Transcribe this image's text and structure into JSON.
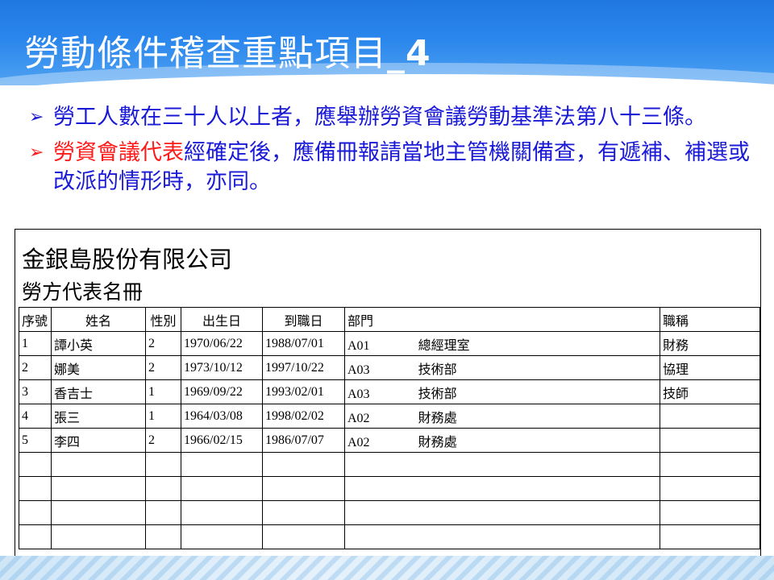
{
  "slide": {
    "title_main": "勞動條件稽查重點項目",
    "title_suffix": "_4",
    "bullets": [
      {
        "text": "勞工人數在三十人以上者，應舉辦勞資會議勞動基準法第八十三條。"
      },
      {
        "red": "勞資會議代表",
        "text": "經確定後，應備冊報請當地主管機關備查，有遞補、補選或改派的情形時，亦同。"
      }
    ]
  },
  "document": {
    "company": "金銀島股份有限公司",
    "subtitle": "勞方代表名冊",
    "columns": [
      "序號",
      "姓名",
      "性別",
      "出生日",
      "到職日",
      "部門",
      "職稱"
    ],
    "rows": [
      {
        "no": "1",
        "name": "譚小英",
        "gender": "2",
        "birth": "1970/06/22",
        "hire": "1988/07/01",
        "dept_code": "A01",
        "dept_name": "總經理室",
        "title": "財務"
      },
      {
        "no": "2",
        "name": "娜美",
        "gender": "2",
        "birth": "1973/10/12",
        "hire": "1997/10/22",
        "dept_code": "A03",
        "dept_name": "技術部",
        "title": "協理"
      },
      {
        "no": "3",
        "name": "香吉士",
        "gender": "1",
        "birth": "1969/09/22",
        "hire": "1993/02/01",
        "dept_code": "A03",
        "dept_name": "技術部",
        "title": "技師"
      },
      {
        "no": "4",
        "name": "張三",
        "gender": "1",
        "birth": "1964/03/08",
        "hire": "1998/02/02",
        "dept_code": "A02",
        "dept_name": "財務處",
        "title": ""
      },
      {
        "no": "5",
        "name": "李四",
        "gender": "2",
        "birth": "1966/02/15",
        "hire": "1986/07/07",
        "dept_code": "A02",
        "dept_name": "財務處",
        "title": ""
      }
    ]
  }
}
